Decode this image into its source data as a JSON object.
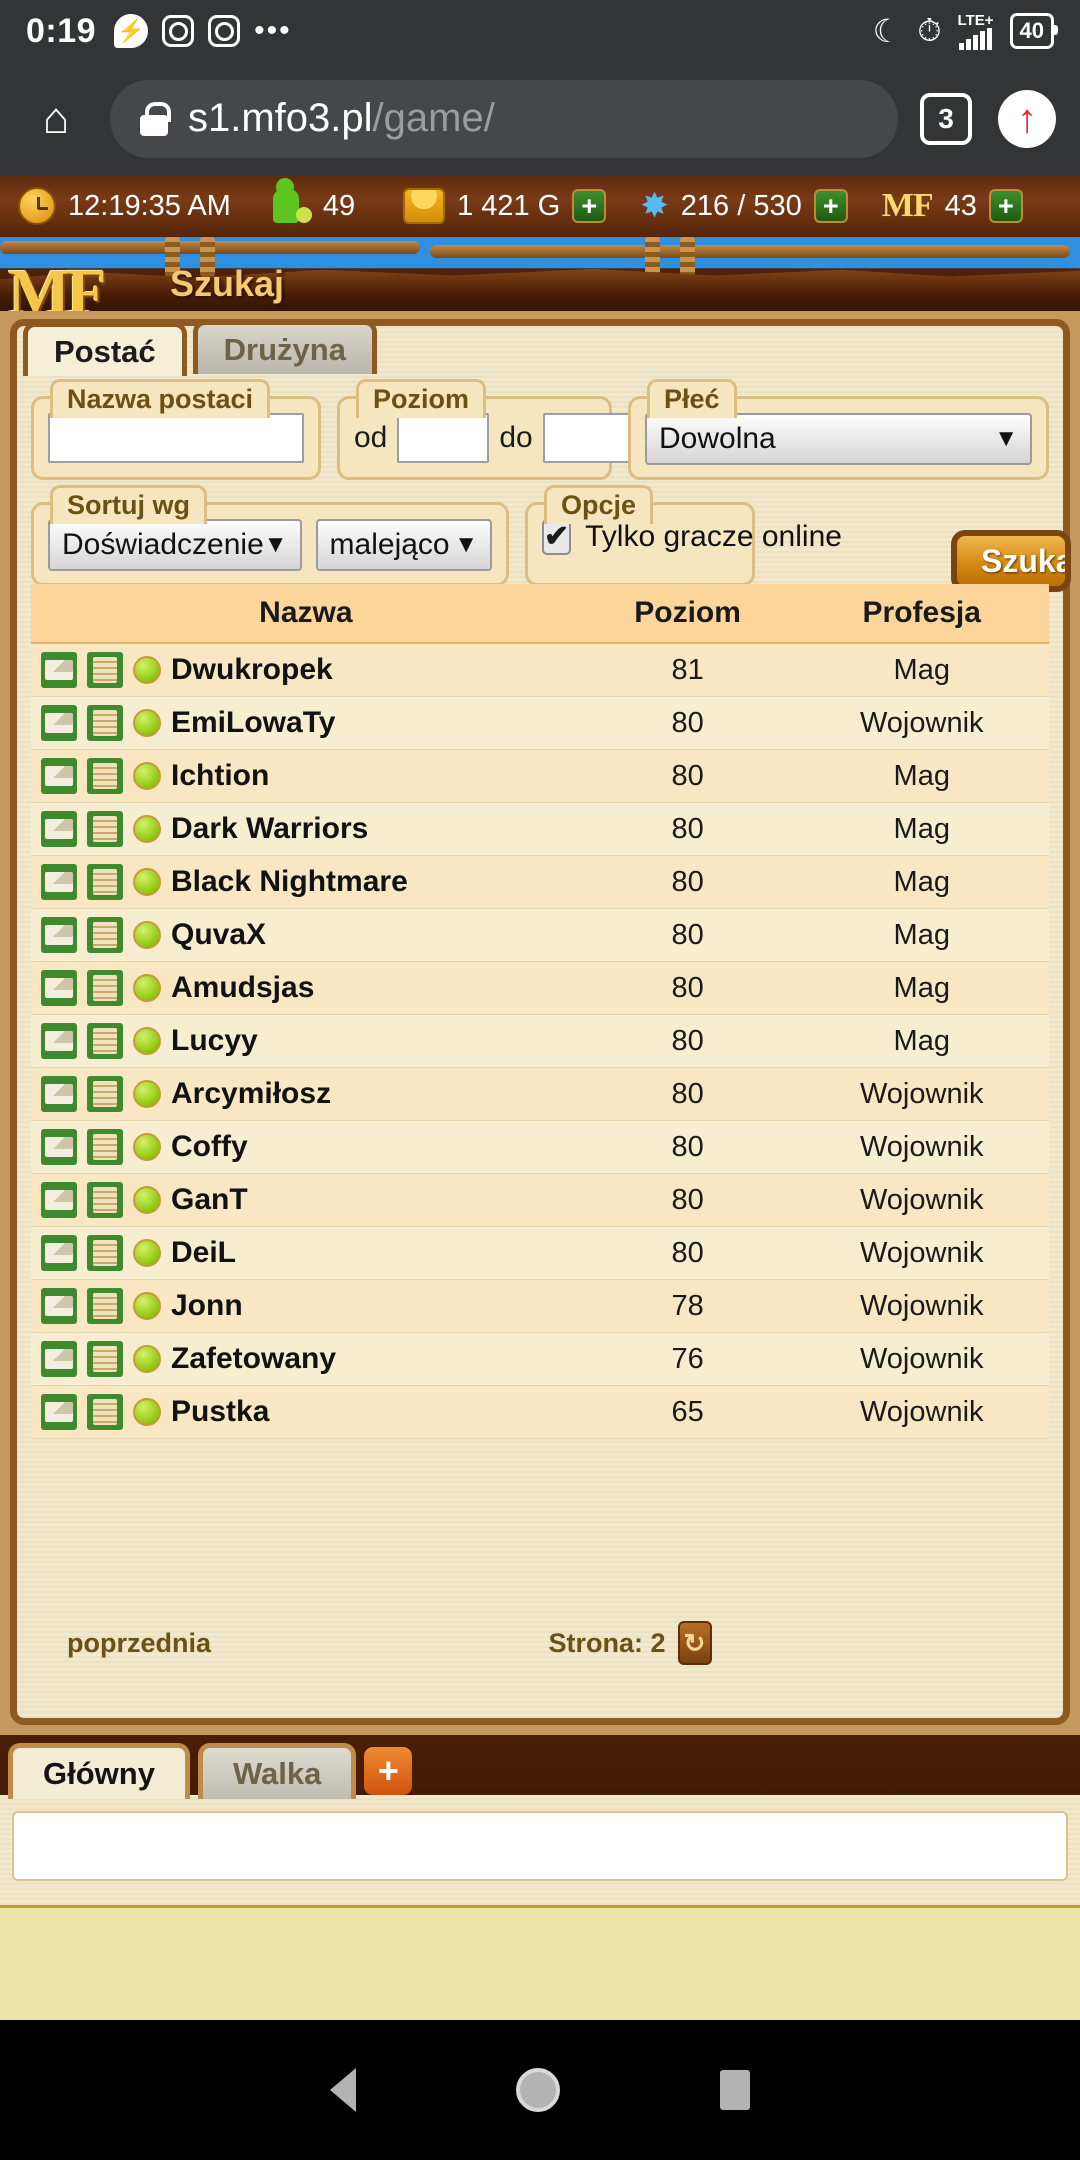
{
  "android_status": {
    "clock": "0:19",
    "icons": [
      "messenger-icon",
      "instagram-icon",
      "instagram-icon",
      "more-dots-icon"
    ],
    "dnd": "☾",
    "alarm": "⏰",
    "network": "LTE+",
    "battery": "40"
  },
  "browser": {
    "home_icon": "⌂",
    "url_host": "s1.mfo3.pl",
    "url_path": "/game/",
    "tab_count": "3",
    "up_arrow": "↑"
  },
  "game_resources": {
    "time": "12:19:35 AM",
    "players_online": "49",
    "gold": "1 421 G",
    "energy": "216 / 530",
    "mf_label": "MF",
    "mf_value": "43",
    "plus": "+"
  },
  "banner": {
    "logo": "MF",
    "title": "Szukaj"
  },
  "tabs": [
    {
      "label": "Postać",
      "active": true
    },
    {
      "label": "Drużyna",
      "active": false
    }
  ],
  "search_form": {
    "name_legend": "Nazwa postaci",
    "name_value": "",
    "level_legend": "Poziom",
    "level_from_label": "od",
    "level_from_value": "",
    "level_to_label": "do",
    "level_to_value": "",
    "sex_legend": "Płeć",
    "sex_value": "Dowolna",
    "sort_legend": "Sortuj wg",
    "sort_by_value": "Doświadczenie",
    "sort_dir_value": "malejąco",
    "options_legend": "Opcje",
    "online_only_label": "Tylko gracze online",
    "online_only_checked": true,
    "checkmark": "✔",
    "arrow": "▼",
    "search_button": "Szukaj"
  },
  "results": {
    "columns": [
      "Nazwa",
      "Poziom",
      "Profesja"
    ],
    "rows": [
      {
        "name": "Dwukropek",
        "level": "81",
        "profession": "Mag"
      },
      {
        "name": "EmiLowaTy",
        "level": "80",
        "profession": "Wojownik"
      },
      {
        "name": "Ichtion",
        "level": "80",
        "profession": "Mag"
      },
      {
        "name": "Dark Warriors",
        "level": "80",
        "profession": "Mag"
      },
      {
        "name": "Black Nightmare",
        "level": "80",
        "profession": "Mag"
      },
      {
        "name": "QuvaX",
        "level": "80",
        "profession": "Mag"
      },
      {
        "name": "Amudsjas",
        "level": "80",
        "profession": "Mag"
      },
      {
        "name": "Lucyy",
        "level": "80",
        "profession": "Mag"
      },
      {
        "name": "Arcymiłosz",
        "level": "80",
        "profession": "Wojownik"
      },
      {
        "name": "Coffy",
        "level": "80",
        "profession": "Wojownik"
      },
      {
        "name": "GanT",
        "level": "80",
        "profession": "Wojownik"
      },
      {
        "name": "DeiL",
        "level": "80",
        "profession": "Wojownik"
      },
      {
        "name": "Jonn",
        "level": "78",
        "profession": "Wojownik"
      },
      {
        "name": "Zafetowany",
        "level": "76",
        "profession": "Wojownik"
      },
      {
        "name": "Pustka",
        "level": "65",
        "profession": "Wojownik"
      }
    ]
  },
  "pagination": {
    "prev_label": "poprzednia",
    "page_label": "Strona: 2",
    "refresh_icon": "↻"
  },
  "chat": {
    "tabs": [
      {
        "label": "Główny",
        "active": true
      },
      {
        "label": "Walka",
        "active": false
      }
    ],
    "add_tab": "+",
    "input_value": ""
  },
  "android_nav": {
    "back": "back-triangle-icon",
    "home": "home-circle-icon",
    "recents": "recents-square-icon"
  }
}
